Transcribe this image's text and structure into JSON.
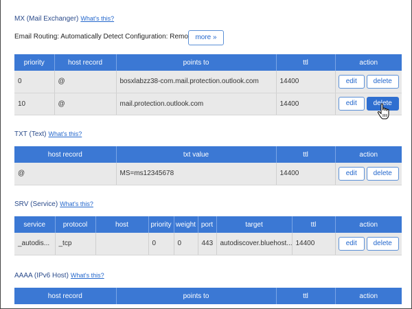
{
  "mx": {
    "title": "MX (Mail Exchanger)",
    "whats_this": "What's this?",
    "routing_label": "Email Routing: Automatically Detect Configuration: Remote",
    "more_label": "more »",
    "headers": [
      "priority",
      "host record",
      "points to",
      "ttl",
      "action"
    ],
    "rows": [
      {
        "priority": "0",
        "host": "@",
        "points_to": "bosxlabzz38-com.mail.protection.outlook.com",
        "ttl": "14400"
      },
      {
        "priority": "10",
        "host": "@",
        "points_to": "mail.protection.outlook.com",
        "ttl": "14400"
      }
    ]
  },
  "txt": {
    "title": "TXT (Text)",
    "whats_this": "What's this?",
    "headers": [
      "host record",
      "txt value",
      "ttl",
      "action"
    ],
    "rows": [
      {
        "host": "@",
        "value": "MS=ms12345678",
        "ttl": "14400"
      }
    ]
  },
  "srv": {
    "title": "SRV (Service)",
    "whats_this": "What's this?",
    "headers": [
      "service",
      "protocol",
      "host",
      "priority",
      "weight",
      "port",
      "target",
      "ttl",
      "action"
    ],
    "rows": [
      {
        "service": "_autodis...",
        "protocol": "_tcp",
        "host": "",
        "priority": "0",
        "weight": "0",
        "port": "443",
        "target": "autodiscover.bluehost....",
        "ttl": "14400"
      }
    ]
  },
  "aaaa": {
    "title": "AAAA (IPv6 Host)",
    "whats_this": "What's this?",
    "headers": [
      "host record",
      "points to",
      "ttl",
      "action"
    ]
  },
  "actions": {
    "edit": "edit",
    "delete": "delete"
  },
  "icons": {
    "cursor": "hand-pointer-icon"
  },
  "colors": {
    "header_bg": "#3b78d4",
    "row_bg": "#e9e9e9",
    "link": "#2266cc",
    "active_button": "#2f6fd0"
  }
}
